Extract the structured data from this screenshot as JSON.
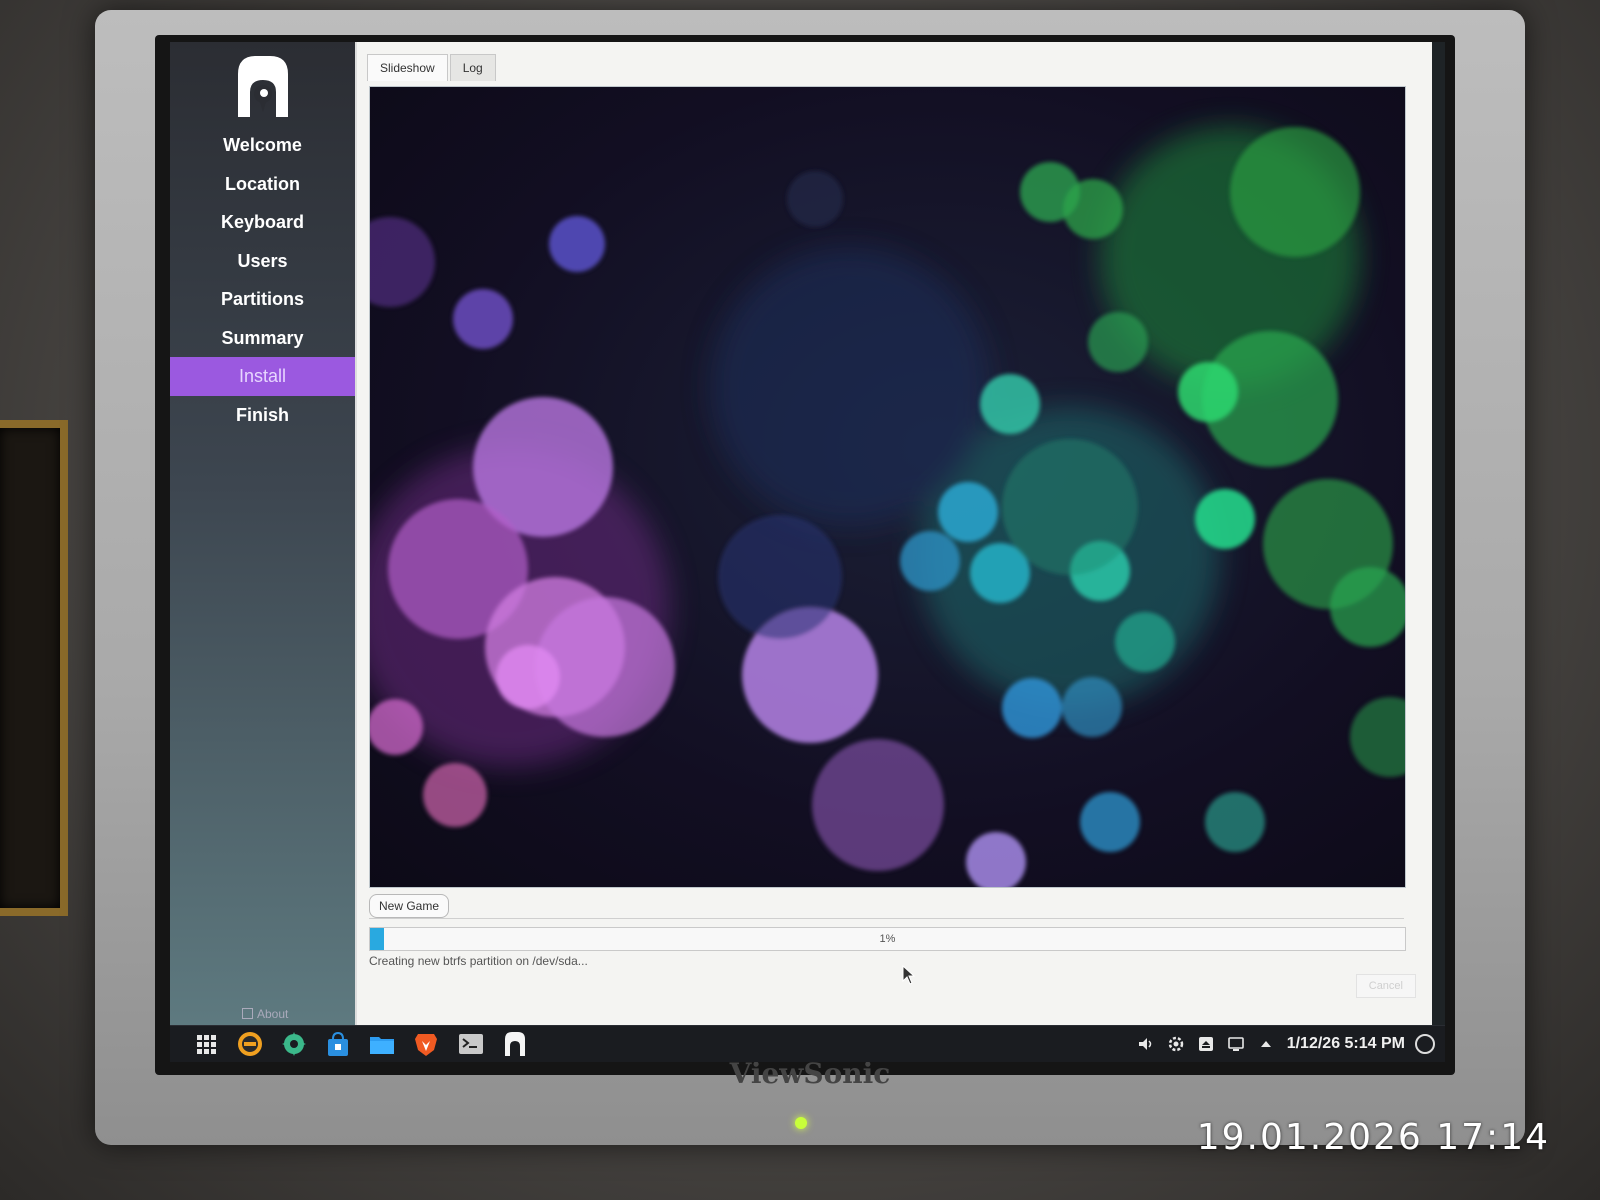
{
  "installer": {
    "sidebar": {
      "items": [
        {
          "label": "Welcome"
        },
        {
          "label": "Location"
        },
        {
          "label": "Keyboard"
        },
        {
          "label": "Users"
        },
        {
          "label": "Partitions"
        },
        {
          "label": "Summary"
        },
        {
          "label": "Install"
        },
        {
          "label": "Finish"
        }
      ],
      "active_index": 6,
      "about_label": "About"
    },
    "tabs": [
      {
        "label": "Slideshow"
      },
      {
        "label": "Log"
      }
    ],
    "active_tab": 0,
    "new_game_label": "New Game",
    "progress": {
      "percent": 1,
      "label": "1%"
    },
    "status_text": "Creating new btrfs partition on /dev/sda...",
    "cancel_label": "Cancel"
  },
  "taskbar": {
    "apps": [
      {
        "icon": "app-grid-icon"
      },
      {
        "icon": "disk-icon"
      },
      {
        "icon": "settings-gear-icon"
      },
      {
        "icon": "store-bag-icon"
      },
      {
        "icon": "folder-icon"
      },
      {
        "icon": "brave-browser-icon"
      },
      {
        "icon": "terminal-icon"
      },
      {
        "icon": "installer-icon"
      }
    ],
    "tray": [
      "volume-icon",
      "settings-icon",
      "removable-media-icon",
      "network-icon",
      "tray-expand-icon"
    ],
    "clock": "1/12/26 5:14 PM"
  },
  "monitor": {
    "brand": "ViewSonic"
  },
  "photo_timestamp": "19.01.2026 17:14",
  "colors": {
    "accent_active": "#9b59e0",
    "progress_fill": "#29a9e0"
  }
}
